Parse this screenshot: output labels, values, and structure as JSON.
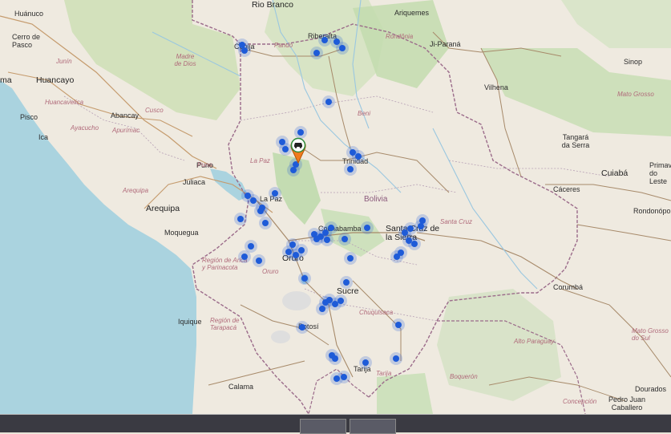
{
  "map": {
    "cities": [
      {
        "name": "Huánuco"
      },
      {
        "name": "Cerro de Pasco"
      },
      {
        "name": "Huancayo"
      },
      {
        "name": "Pisco"
      },
      {
        "name": "Ica"
      },
      {
        "name": "Abancay"
      },
      {
        "name": "Arequipa"
      },
      {
        "name": "Moquegua"
      },
      {
        "name": "Juliaca"
      },
      {
        "name": "Puno"
      },
      {
        "name": "Cobija"
      },
      {
        "name": "Riberalta"
      },
      {
        "name": "Trinidad"
      },
      {
        "name": "La Paz"
      },
      {
        "name": "Cochabamba"
      },
      {
        "name": "Oruro"
      },
      {
        "name": "Santa Cruz de la Sierra"
      },
      {
        "name": "Sucre"
      },
      {
        "name": "Potosí"
      },
      {
        "name": "Tarija"
      },
      {
        "name": "Iquique"
      },
      {
        "name": "Calama"
      },
      {
        "name": "Rio Branco"
      },
      {
        "name": "Ariquemes"
      },
      {
        "name": "Ji-Paraná"
      },
      {
        "name": "Vilhena"
      },
      {
        "name": "Sinop"
      },
      {
        "name": "Tangará da Serra"
      },
      {
        "name": "Cáceres"
      },
      {
        "name": "Cuiabá"
      },
      {
        "name": "Primavera do Leste"
      },
      {
        "name": "Rondonópolis"
      },
      {
        "name": "Corumbá"
      },
      {
        "name": "Dourados"
      },
      {
        "name": "Pedro Juan Caballero"
      }
    ],
    "regions": [
      {
        "name": "Madre de Dios"
      },
      {
        "name": "Junín"
      },
      {
        "name": "Huancavelica"
      },
      {
        "name": "Ayacucho"
      },
      {
        "name": "Apurímac"
      },
      {
        "name": "Cusco"
      },
      {
        "name": "Arequipa"
      },
      {
        "name": "Puno"
      },
      {
        "name": "Región de Arica y Parinacota"
      },
      {
        "name": "Región de Tarapacá"
      },
      {
        "name": "Rondônia"
      },
      {
        "name": "Mato Grosso"
      },
      {
        "name": "Mato Grosso do Sul"
      },
      {
        "name": "Pando"
      },
      {
        "name": "Beni"
      },
      {
        "name": "La Paz"
      },
      {
        "name": "Oruro"
      },
      {
        "name": "Chuquisaca"
      },
      {
        "name": "Tarija"
      },
      {
        "name": "Santa Cruz"
      },
      {
        "name": "Alto Paraguay"
      },
      {
        "name": "Boquerón"
      },
      {
        "name": "Concepción"
      }
    ],
    "country_label": "Bolivia",
    "partial_label": "ma",
    "selected_marker": {
      "icon": "car-icon"
    },
    "marker_color": "#1e5bd8"
  },
  "bottom_bar": {
    "items": [
      {
        "id": "item-1"
      },
      {
        "id": "item-2"
      }
    ]
  }
}
